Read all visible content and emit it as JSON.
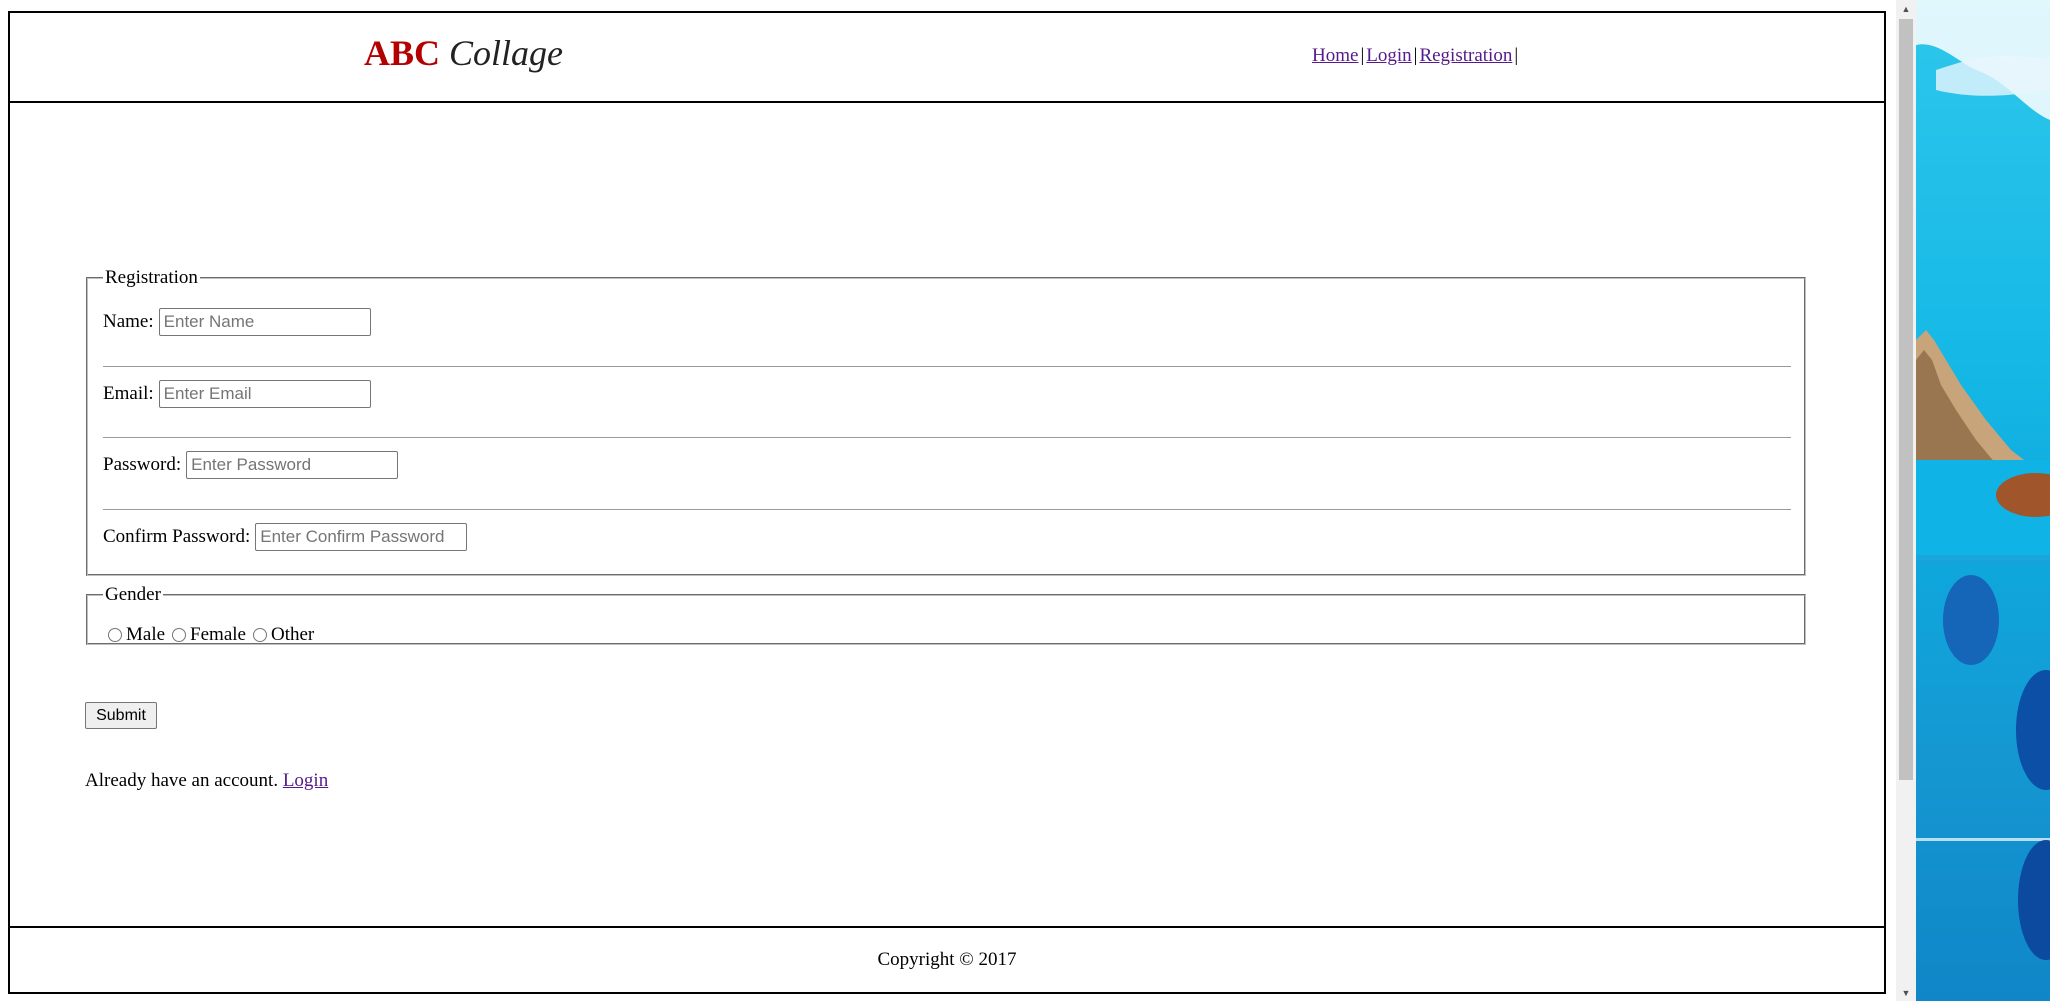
{
  "header": {
    "logo_part1": "ABC",
    "logo_part2": "Collage",
    "nav": {
      "home": "Home",
      "login": "Login",
      "registration": "Registration"
    }
  },
  "registration": {
    "legend": "Registration",
    "name_label": "Name:",
    "name_placeholder": "Enter Name",
    "email_label": "Email:",
    "email_placeholder": "Enter Email",
    "password_label": "Password:",
    "password_placeholder": "Enter Password",
    "confirm_label": "Confirm Password:",
    "confirm_placeholder": "Enter Confirm Password"
  },
  "gender": {
    "legend": "Gender",
    "options": [
      "Male",
      "Female",
      "Other"
    ]
  },
  "submit_label": "Submit",
  "account": {
    "text": "Already have an account.",
    "link": "Login"
  },
  "footer": {
    "copyright": "Copyright © 2017"
  },
  "colors": {
    "logo_abc": "#b30000",
    "link": "#551a8b"
  }
}
